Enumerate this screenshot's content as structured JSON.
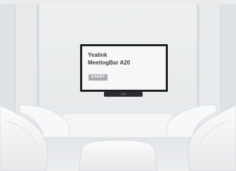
{
  "screen": {
    "title": "Yealink",
    "subtitle": "MeetingBar A20",
    "button_label": "START"
  }
}
